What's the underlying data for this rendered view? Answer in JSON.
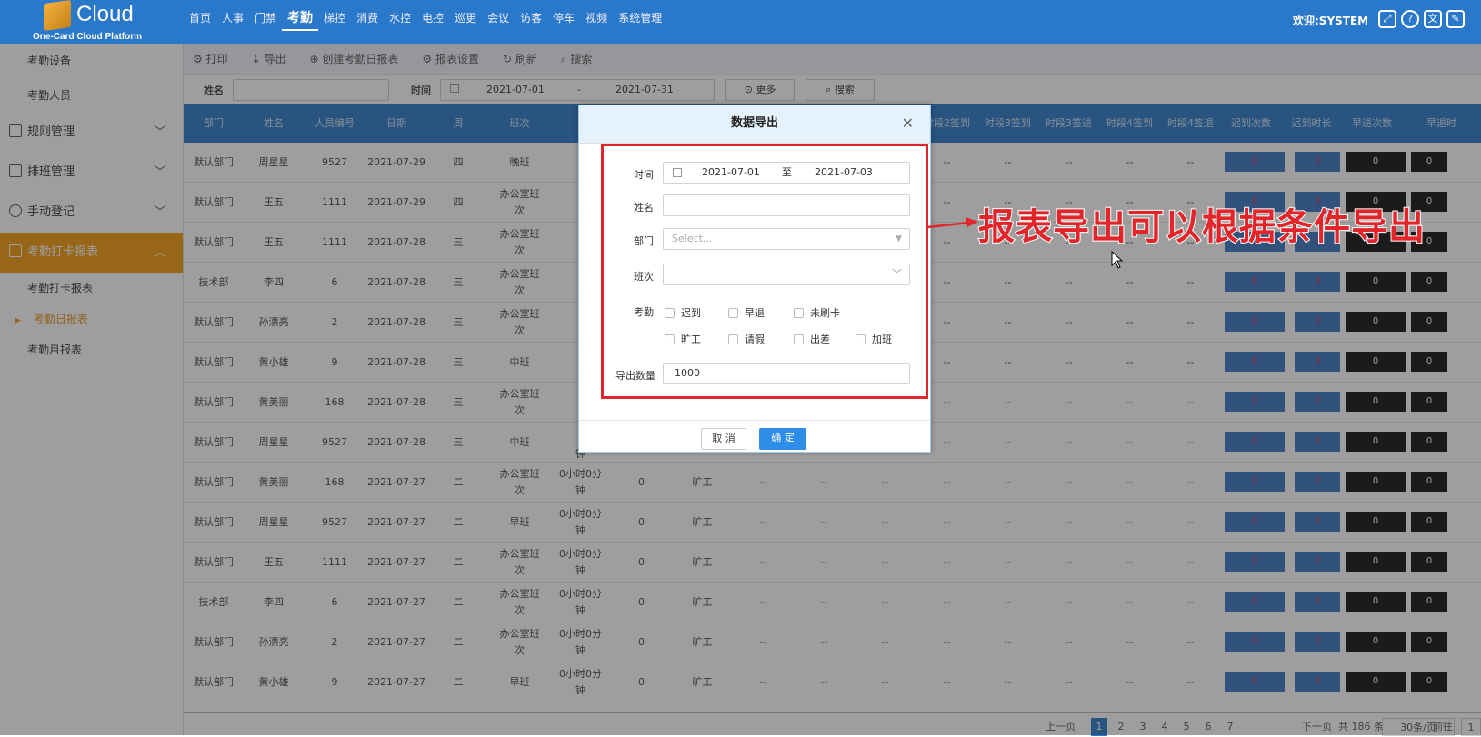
{
  "app": {
    "logo_text": "Cloud",
    "logo_sub": "One-Card Cloud Platform"
  },
  "topnav": [
    "首页",
    "人事",
    "门禁",
    "考勤",
    "梯控",
    "消费",
    "水控",
    "电控",
    "巡更",
    "会议",
    "访客",
    "停车",
    "视频",
    "系统管理"
  ],
  "topnav_active": "考勤",
  "welcome": "欢迎:SYSTEM",
  "sidebar": {
    "top_items": [
      "考勤设备",
      "考勤人员"
    ],
    "groups": [
      "规则管理",
      "排班管理",
      "手动登记"
    ],
    "active_group": "考勤打卡报表",
    "sub_items": [
      "考勤打卡报表",
      "考勤日报表",
      "考勤月报表"
    ]
  },
  "toolbar": {
    "print": "打印",
    "export": "导出",
    "create": "创建考勤日报表",
    "settings": "报表设置",
    "refresh": "刷新",
    "search": "搜索"
  },
  "filter": {
    "name_label": "姓名",
    "time_label": "时间",
    "date_from": "2021-07-01",
    "date_sep": "-",
    "date_to": "2021-07-31",
    "more": "更多",
    "search": "搜索"
  },
  "table": {
    "headers": [
      "部门",
      "姓名",
      "人员编号",
      "日期",
      "周",
      "班次",
      "时段2签到",
      "时段3签到",
      "时段3签退",
      "时段4签到",
      "时段4签退",
      "迟到次数",
      "迟到时长",
      "早退次数",
      "早退时"
    ],
    "rows": [
      [
        "默认部门",
        "周星星",
        "9527",
        "2021-07-29",
        "四",
        "晚班"
      ],
      [
        "默认部门",
        "王五",
        "1111",
        "2021-07-29",
        "四",
        "办公室班次"
      ],
      [
        "默认部门",
        "王五",
        "1111",
        "2021-07-28",
        "三",
        "办公室班次"
      ],
      [
        "技术部",
        "李四",
        "6",
        "2021-07-28",
        "三",
        "办公室班次"
      ],
      [
        "默认部门",
        "孙漂亮",
        "2",
        "2021-07-28",
        "三",
        "办公室班次"
      ],
      [
        "默认部门",
        "黄小雄",
        "9",
        "2021-07-28",
        "三",
        "中班"
      ],
      [
        "默认部门",
        "黄美丽",
        "168",
        "2021-07-28",
        "三",
        "办公室班次"
      ],
      [
        "默认部门",
        "周星星",
        "9527",
        "2021-07-28",
        "三",
        "中班"
      ],
      [
        "默认部门",
        "黄美丽",
        "168",
        "2021-07-27",
        "二",
        "办公室班次"
      ],
      [
        "默认部门",
        "周星星",
        "9527",
        "2021-07-27",
        "二",
        "早班"
      ],
      [
        "默认部门",
        "王五",
        "1111",
        "2021-07-27",
        "二",
        "办公室班次"
      ],
      [
        "技术部",
        "李四",
        "6",
        "2021-07-27",
        "二",
        "办公室班次"
      ],
      [
        "默认部门",
        "孙漂亮",
        "2",
        "2021-07-27",
        "二",
        "办公室班次"
      ],
      [
        "默认部门",
        "黄小雄",
        "9",
        "2021-07-27",
        "二",
        "早班"
      ]
    ],
    "extra_cols": {
      "duration": "0小时0分钟",
      "zero": "0",
      "status": "旷工",
      "dash": "--"
    },
    "last_row_fragment": "钟"
  },
  "pager": {
    "prev": "上一页",
    "pages": [
      "1",
      "2",
      "3",
      "4",
      "5",
      "6",
      "7"
    ],
    "next": "下一页",
    "total": "共 186 条",
    "per_page": "30条/页",
    "goto": "前往",
    "goto_value": "1"
  },
  "modal": {
    "title": "数据导出",
    "time_label": "时间",
    "date_from": "2021-07-01",
    "date_sep": "至",
    "date_to": "2021-07-03",
    "name_label": "姓名",
    "dept_label": "部门",
    "dept_placeholder": "Select...",
    "shift_label": "班次",
    "attend_label": "考勤",
    "checks": [
      "迟到",
      "早退",
      "未刷卡",
      "旷工",
      "请假",
      "出差",
      "加班"
    ],
    "count_label": "导出数量",
    "count_value": "1000",
    "cancel": "取 消",
    "ok": "确 定"
  },
  "callout": "报表导出可以根据条件导出",
  "colors": {
    "topbar": "#2a78c9",
    "active": "#f39a0e",
    "annotation": "#e0262b"
  }
}
